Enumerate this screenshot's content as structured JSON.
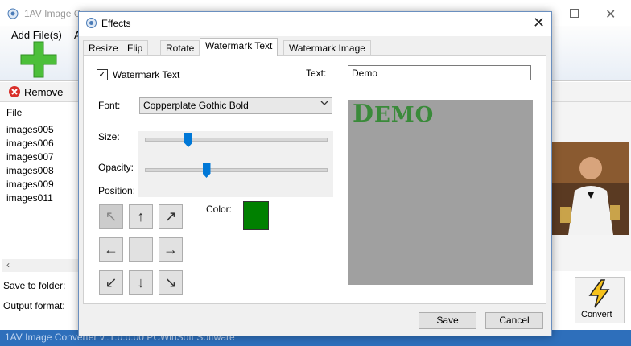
{
  "main": {
    "title": "1AV Image Co",
    "add_files": "Add File(s)",
    "add_files_next": "A",
    "remove": "Remove",
    "file_header": "File",
    "files": [
      "images005",
      "images006",
      "images007",
      "images008",
      "images009",
      "images011"
    ],
    "save_folder": "Save to folder:",
    "output_format": "Output format:",
    "convert": "Convert",
    "status": "1AV Image Converter v.:1.0.0.00 PCWinSoft Software"
  },
  "dialog": {
    "title": "Effects",
    "tabs": [
      "Resize",
      "Flip",
      "Rotate",
      "Watermark Text",
      "Watermark Image"
    ],
    "active_tab": "Watermark Text",
    "watermark_checkbox_label": "Watermark Text",
    "watermark_checked": true,
    "text_label": "Text:",
    "text_value": "Demo",
    "font_label": "Font:",
    "font_value": "Copperplate Gothic Bold",
    "size_label": "Size:",
    "size_value": 0.24,
    "opacity_label": "Opacity:",
    "opacity_value": 0.34,
    "position_label": "Position:",
    "position_buttons": [
      "↖",
      "↑",
      "↗",
      "←",
      "",
      "→",
      "↙",
      "↓",
      "↘"
    ],
    "active_position": 0,
    "color_label": "Color:",
    "color_value": "#008000",
    "preview_text": "Demo",
    "save": "Save",
    "cancel": "Cancel"
  }
}
